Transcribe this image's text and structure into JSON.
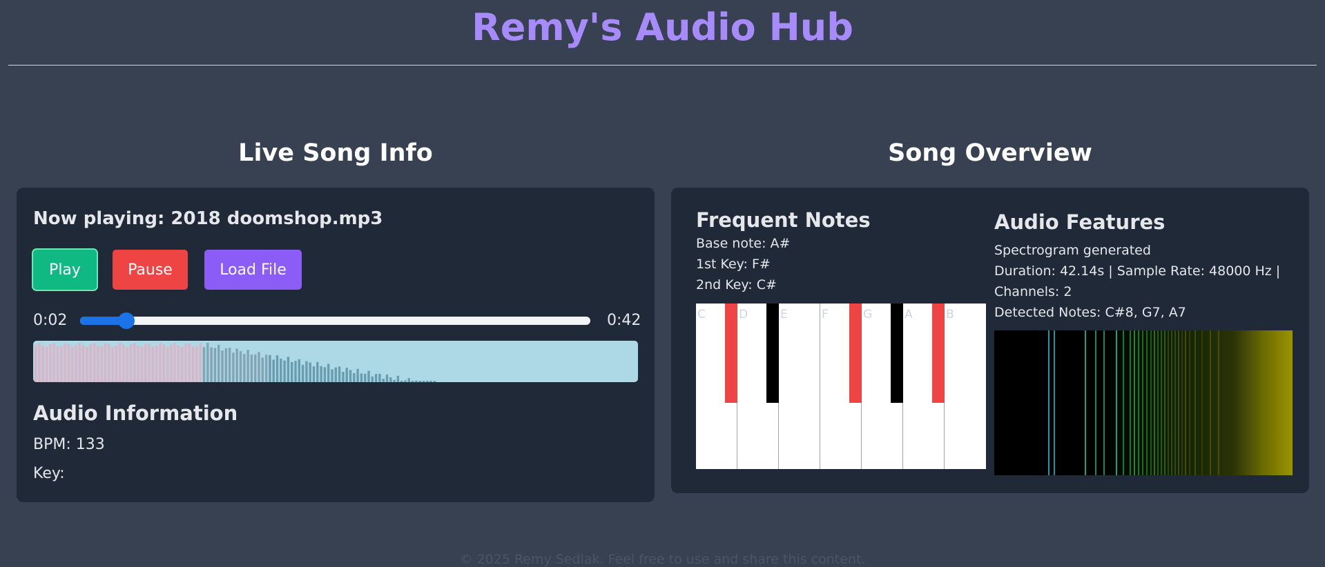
{
  "header": {
    "title": "Remy's Audio Hub"
  },
  "live": {
    "section_title": "Live Song Info",
    "now_playing": "Now playing: 2018 doomshop.mp3",
    "buttons": {
      "play": "Play",
      "pause": "Pause",
      "load": "Load File"
    },
    "current_time": "0:02",
    "total_time": "0:42",
    "progress_fraction": 0.09,
    "audio_info_title": "Audio Information",
    "bpm": "BPM: 133",
    "key": "Key:"
  },
  "overview": {
    "section_title": "Song Overview",
    "frequent_notes": {
      "title": "Frequent Notes",
      "base_note": "Base note: A#",
      "first_key": "1st Key: F#",
      "second_key": "2nd Key: C#",
      "white_keys": [
        "C",
        "D",
        "E",
        "F",
        "G",
        "A",
        "B"
      ],
      "black_keys": [
        {
          "note": "C#",
          "highlighted": true
        },
        {
          "note": "D#",
          "highlighted": false
        },
        {
          "note": "F#",
          "highlighted": true
        },
        {
          "note": "G#",
          "highlighted": false
        },
        {
          "note": "A#",
          "highlighted": true
        }
      ]
    },
    "features": {
      "title": "Audio Features",
      "line1": "Spectrogram generated",
      "line2": "Duration: 42.14s | Sample Rate: 48000 Hz |",
      "line3": "Channels: 2",
      "line4": "Detected Notes: C#8, G7, A7"
    }
  },
  "colors": {
    "accent": "#a78bfa",
    "play": "#10b981",
    "pause": "#ef4444",
    "load": "#8b5cf6",
    "slider": "#1a73e8",
    "key_highlight": "#ef4444"
  },
  "footer": {
    "text": "© 2025 Remy Sedlak. Feel free to use and share this content."
  }
}
